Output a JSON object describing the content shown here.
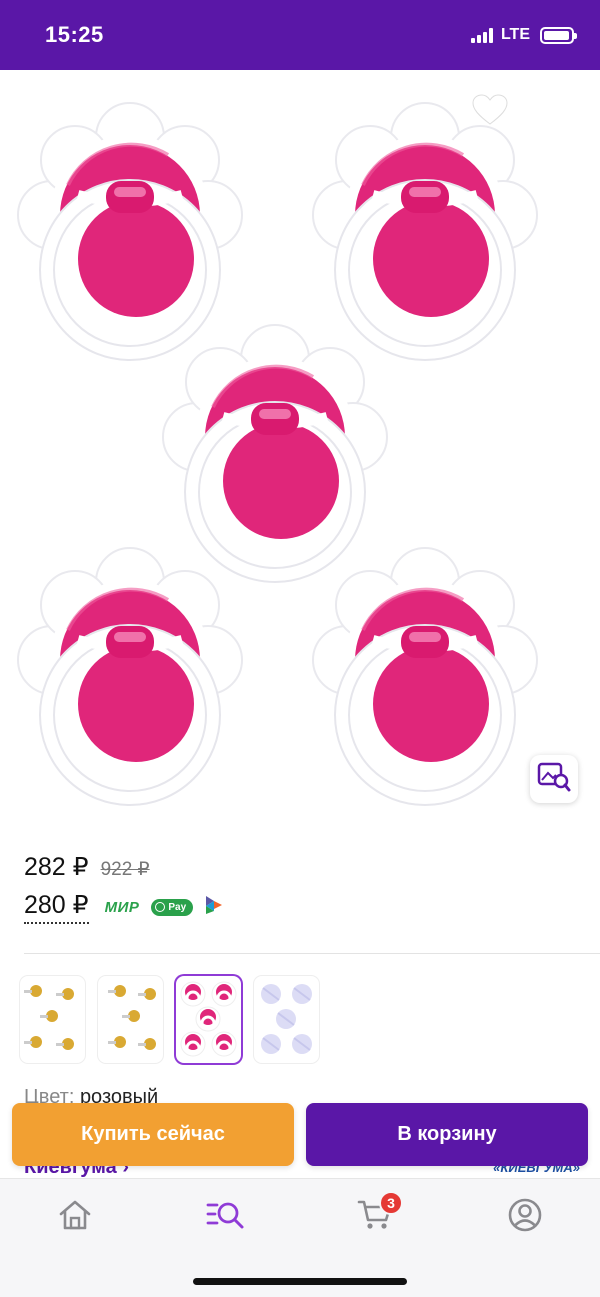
{
  "status_bar": {
    "time": "15:25",
    "network": "LTE",
    "battery_level": 0.95
  },
  "gallery": {
    "icons": {
      "back": "chevron-left-icon",
      "favorite": "heart-icon",
      "share": "share-icon",
      "image_search": "image-search-icon"
    }
  },
  "price": {
    "current": "282 ₽",
    "old": "922 ₽",
    "with_card": "280 ₽",
    "payment_methods": {
      "mir": "МИР",
      "sbp": "Pay"
    }
  },
  "thumbnails": {
    "count": 4,
    "selected_index": 2
  },
  "details": {
    "color_label": "Цвет:",
    "color_value": "розовый",
    "brand": "Киевгума ›",
    "brand_logo": "«КИЕВГУМА»"
  },
  "actions": {
    "buy_now": "Купить сейчас",
    "add_to_cart": "В корзину"
  },
  "tab_bar": {
    "tabs": [
      {
        "name": "home",
        "icon": "home-icon"
      },
      {
        "name": "catalog-search",
        "icon": "search-list-icon"
      },
      {
        "name": "cart",
        "icon": "cart-icon",
        "badge": "3"
      },
      {
        "name": "profile",
        "icon": "profile-icon"
      }
    ]
  },
  "colors": {
    "brand_purple": "#5a17a7",
    "buy_orange": "#f2a032",
    "product_pink": "#e0267a",
    "badge_red": "#e53935",
    "payment_green": "#2aa14b"
  }
}
